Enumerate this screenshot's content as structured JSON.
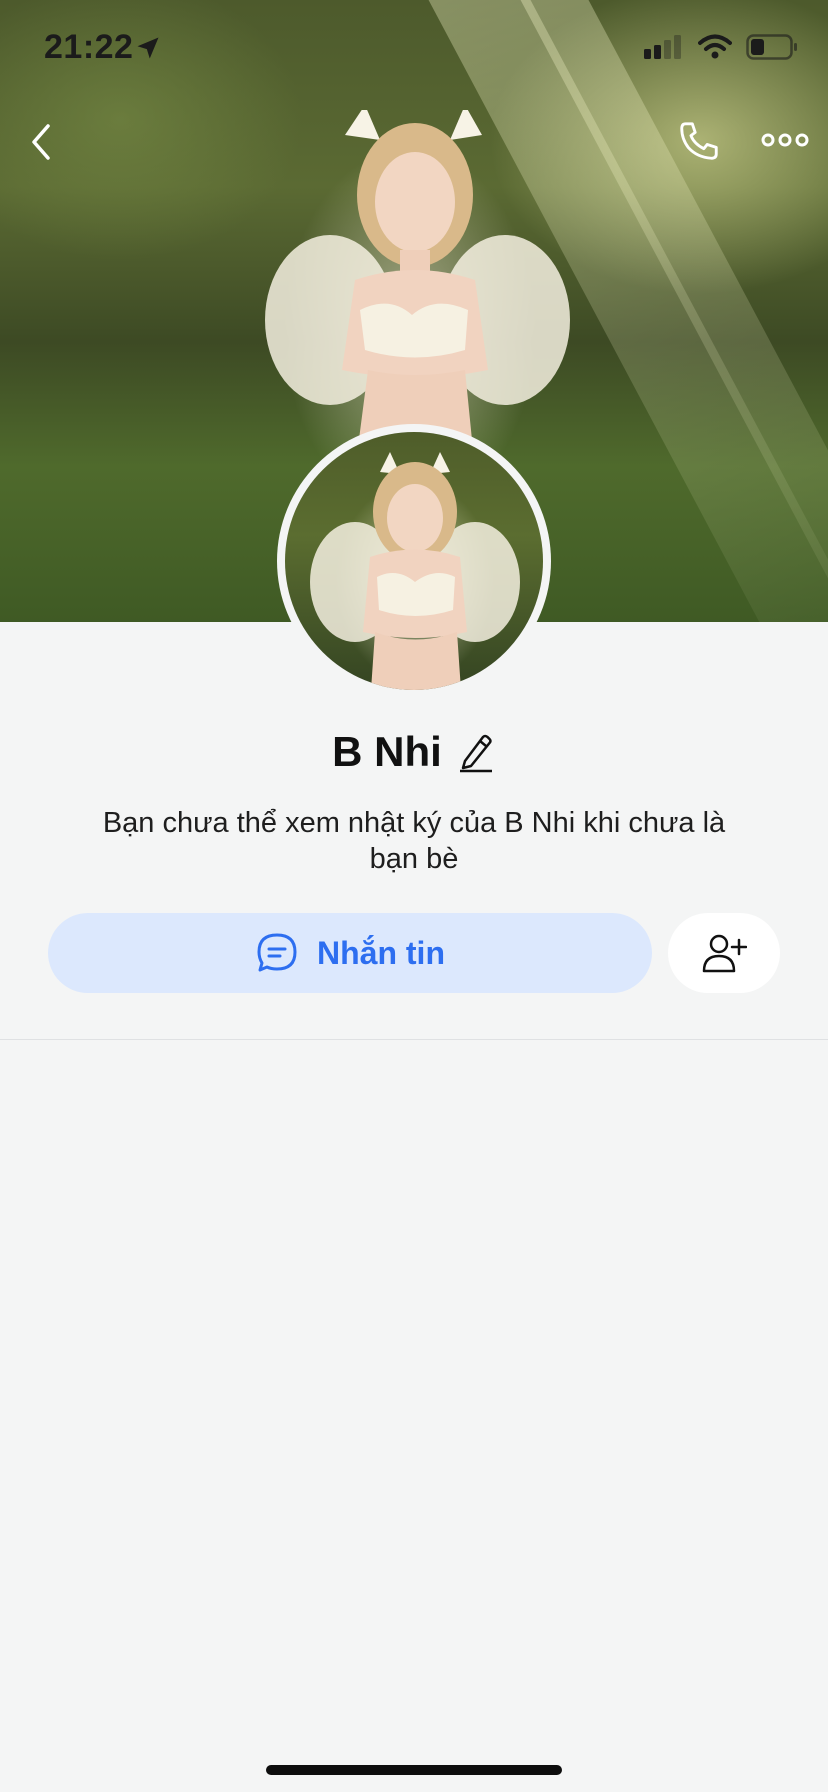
{
  "status_bar": {
    "time": "21:22",
    "icons": [
      "location-arrow-icon",
      "signal-icon",
      "wifi-icon",
      "battery-icon"
    ]
  },
  "header": {
    "back_icon": "chevron-left-icon",
    "call_icon": "phone-icon",
    "more_icon": "more-horizontal-icon"
  },
  "profile": {
    "name": "B Nhi",
    "edit_icon": "pencil-icon",
    "notice": "Bạn chưa thể xem nhật ký của B Nhi khi chưa là bạn bè"
  },
  "actions": {
    "message_label": "Nhắn tin",
    "message_icon": "chat-bubble-icon",
    "add_friend_icon": "add-friend-icon"
  },
  "colors": {
    "accent": "#2d6ef0",
    "message_button_bg": "#dce8fd",
    "page_bg": "#f4f5f5"
  }
}
